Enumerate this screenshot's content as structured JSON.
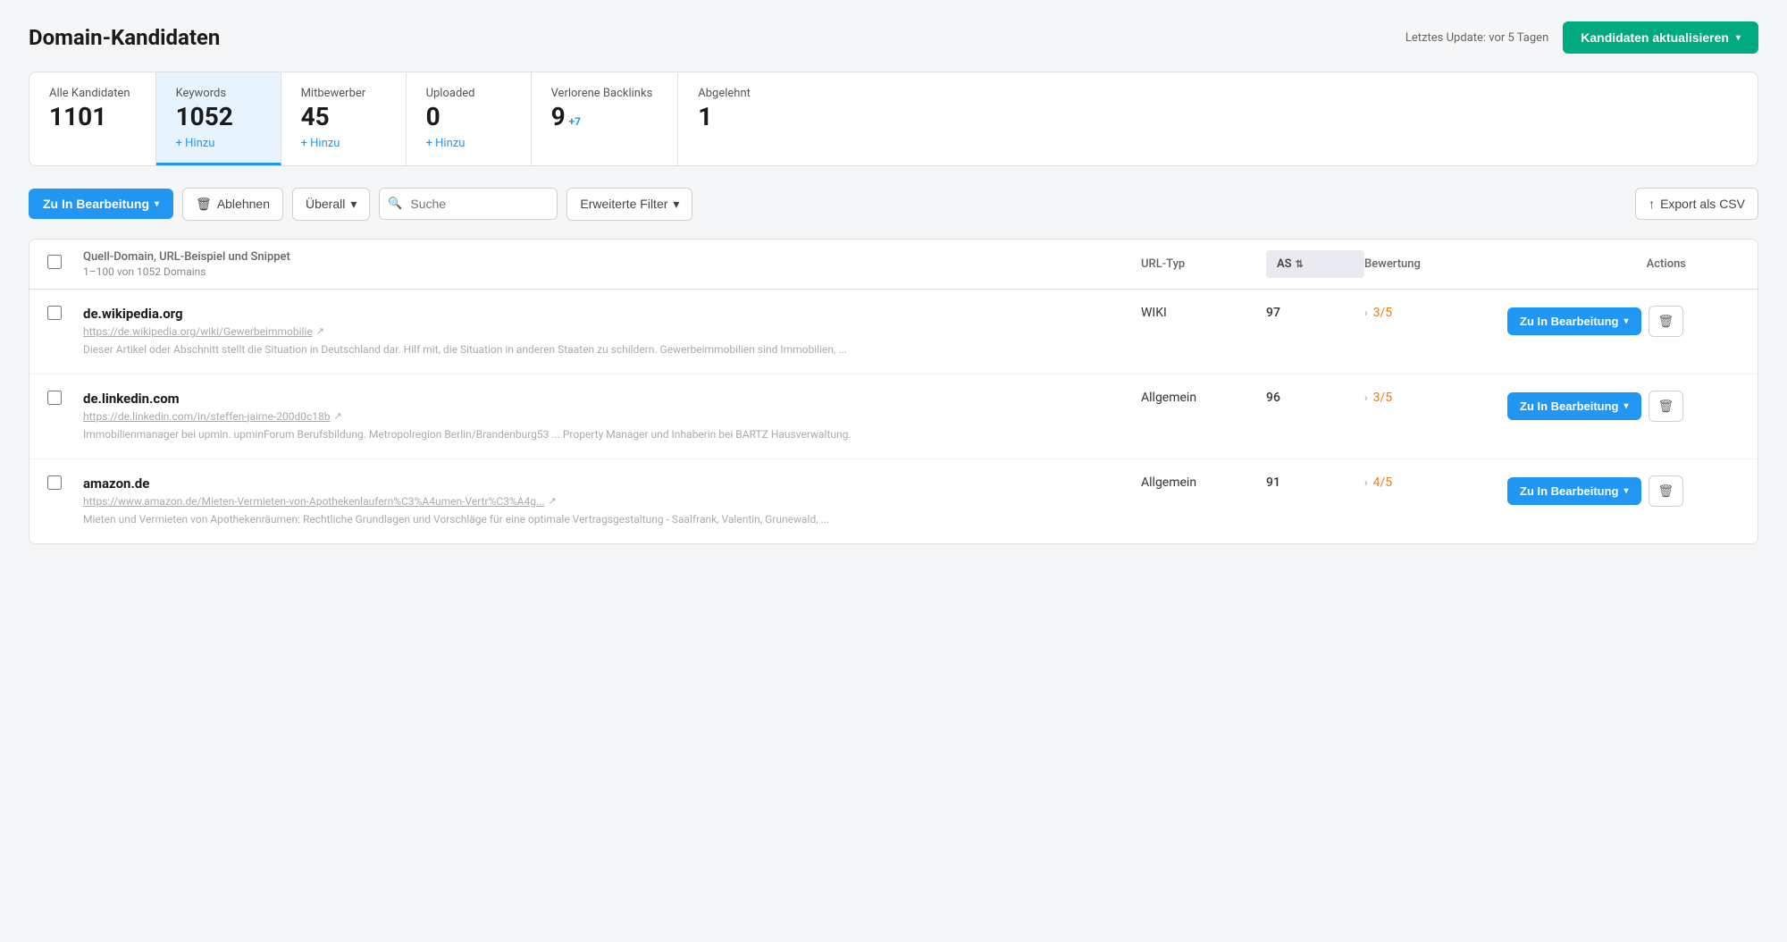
{
  "page": {
    "title": "Domain-Kandidaten",
    "lastUpdate": "Letztes Update: vor 5 Tagen",
    "updateButton": "Kandidaten aktualisieren"
  },
  "stats": [
    {
      "id": "alle",
      "label": "Alle Kandidaten",
      "value": "1101",
      "sub": null,
      "active": false
    },
    {
      "id": "keywords",
      "label": "Keywords",
      "value": "1052",
      "sub": "+ Hinzu",
      "active": true
    },
    {
      "id": "mitbewerber",
      "label": "Mitbewerber",
      "value": "45",
      "sub": "+ Hinzu",
      "active": false
    },
    {
      "id": "uploaded",
      "label": "Uploaded",
      "value": "0",
      "sub": "+ Hinzu",
      "active": false
    },
    {
      "id": "verlorene",
      "label": "Verlorene Backlinks",
      "value": "9",
      "badge": "+7",
      "sub": null,
      "active": false
    },
    {
      "id": "abgelehnt",
      "label": "Abgelehnt",
      "value": "1",
      "sub": null,
      "active": false
    }
  ],
  "toolbar": {
    "primaryButton": "Zu In Bearbeitung",
    "rejectButton": "Ablehnen",
    "filterButton": "Überall",
    "searchPlaceholder": "Suche",
    "advancedFilter": "Erweiterte Filter",
    "exportButton": "Export als CSV"
  },
  "table": {
    "columns": {
      "source": "Quell-Domain, URL-Beispiel und Snippet",
      "subSource": "1–100 von 1052 Domains",
      "urlType": "URL-Typ",
      "as": "AS",
      "rating": "Bewertung",
      "actions": "Actions"
    },
    "rows": [
      {
        "domain": "de.wikipedia.org",
        "url": "https://de.wikipedia.org/wiki/Gewerbeimmobilie",
        "snippet": "Dieser Artikel oder Abschnitt stellt die Situation in Deutschland dar. Hilf mit, die Situation in anderen Staaten zu schildern. Gewerbeimmobilien sind Immobilien, ...",
        "urlType": "WIKI",
        "as": "97",
        "rating": "3/5",
        "actionButton": "Zu In Bearbeitung"
      },
      {
        "domain": "de.linkedin.com",
        "url": "https://de.linkedin.com/in/steffen-jairne-200d0c18b",
        "snippet": "Immobilienmanager bei upmin. upminForum Berufsbildung. Metropolregion Berlin/Brandenburg53 ... Property Manager und Inhaberin bei BARTZ Hausverwaltung.",
        "urlType": "Allgemein",
        "as": "96",
        "rating": "3/5",
        "actionButton": "Zu In Bearbeitung"
      },
      {
        "domain": "amazon.de",
        "url": "https://www.amazon.de/Mieten-Vermieten-von-Apothekenlaufern%C3%A4umen-Vertr%C3%A4g...",
        "snippet": "Mieten und Vermieten von Apothekenräumen: Rechtliche Grundlagen und Vorschläge für eine optimale Vertragsgestaltung - Saalfrank, Valentin, Grunewald, ...",
        "urlType": "Allgemein",
        "as": "91",
        "rating": "4/5",
        "actionButton": "Zu In Bearbeitung"
      }
    ]
  }
}
